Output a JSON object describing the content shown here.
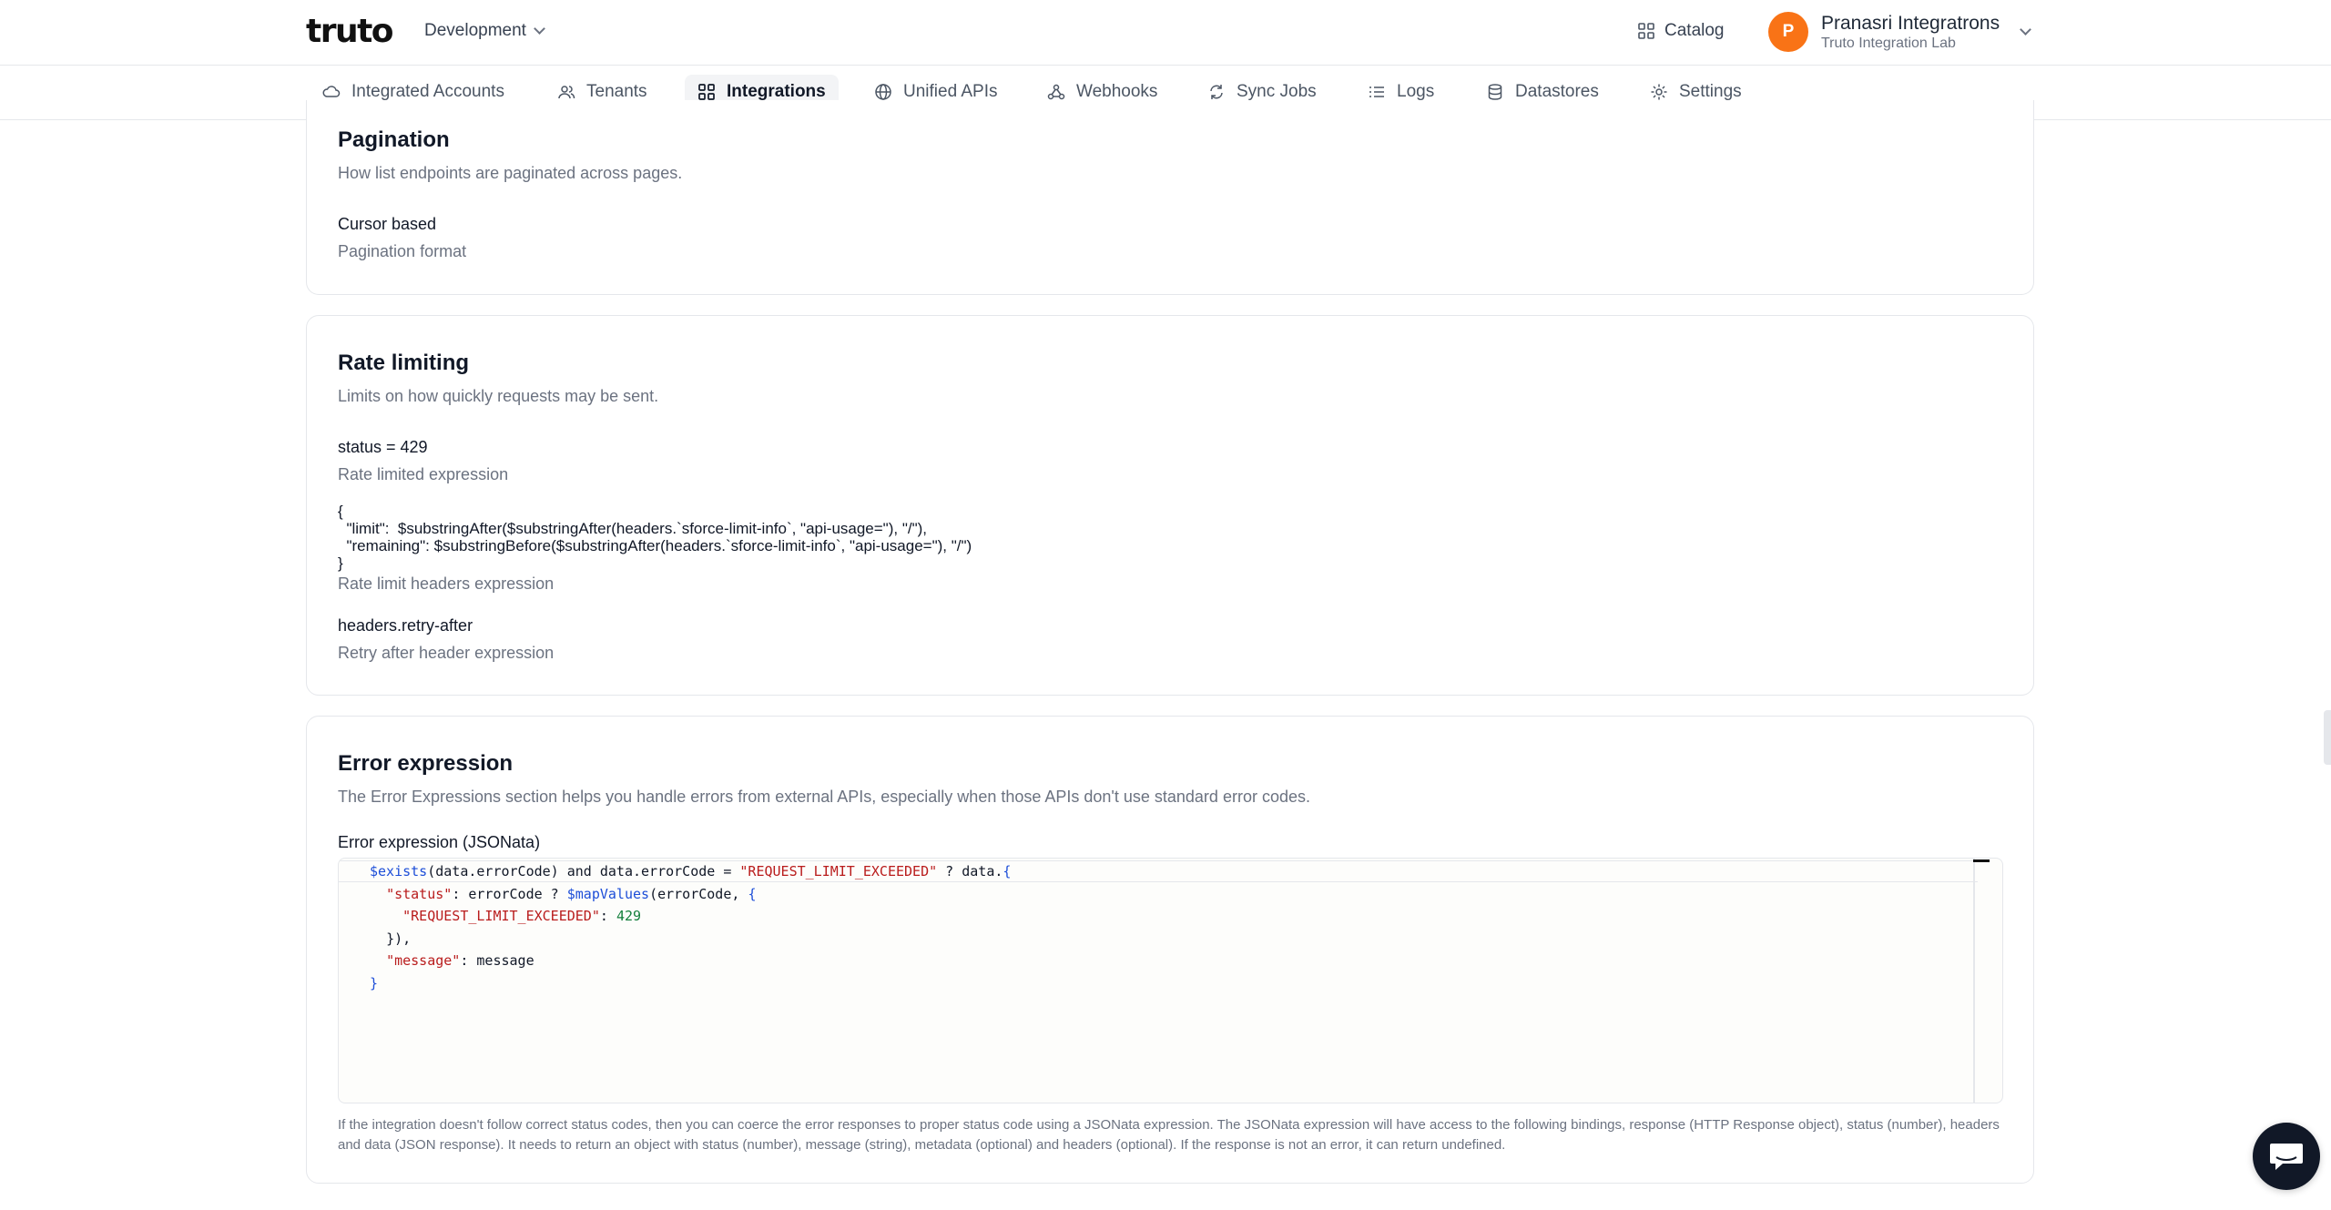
{
  "header": {
    "logo_text": "truto",
    "environment": "Development",
    "catalog_label": "Catalog",
    "user": {
      "initial": "P",
      "name": "Pranasri Integratrons",
      "org": "Truto Integration Lab"
    }
  },
  "nav": {
    "items": [
      {
        "label": "Integrated Accounts",
        "icon": "cloud-icon"
      },
      {
        "label": "Tenants",
        "icon": "users-icon"
      },
      {
        "label": "Integrations",
        "icon": "grid-icon",
        "active": true
      },
      {
        "label": "Unified APIs",
        "icon": "globe-icon"
      },
      {
        "label": "Webhooks",
        "icon": "webhook-icon"
      },
      {
        "label": "Sync Jobs",
        "icon": "sync-icon"
      },
      {
        "label": "Logs",
        "icon": "list-icon"
      },
      {
        "label": "Datastores",
        "icon": "database-icon"
      },
      {
        "label": "Settings",
        "icon": "gear-icon"
      }
    ]
  },
  "pagination": {
    "title": "Pagination",
    "subtitle": "How list endpoints are paginated across pages.",
    "value": "Cursor based",
    "label": "Pagination format"
  },
  "rate_limiting": {
    "title": "Rate limiting",
    "subtitle": "Limits on how quickly requests may be sent.",
    "rate_limited_value": "status = 429",
    "rate_limited_label": "Rate limited expression",
    "headers_expression": "{\n  \"limit\":  $substringAfter($substringAfter(headers.`sforce-limit-info`, \"api-usage=\"), \"/\"),\n  \"remaining\": $substringBefore($substringAfter(headers.`sforce-limit-info`, \"api-usage=\"), \"/\")\n}",
    "headers_label": "Rate limit headers expression",
    "retry_value": "headers.retry-after",
    "retry_label": "Retry after header expression"
  },
  "error_expression": {
    "title": "Error expression",
    "subtitle": "The Error Expressions section helps you handle errors from external APIs, especially when those APIs don't use standard error codes.",
    "field_label": "Error expression (JSONata)",
    "code": {
      "l1_fn": "$exists",
      "l1_a": "(data.errorCode) and data.errorCode = ",
      "l1_str": "\"REQUEST_LIMIT_EXCEEDED\"",
      "l1_b": " ? data.",
      "l1_br": "{",
      "l2_key": "\"status\"",
      "l2_a": ": errorCode ? ",
      "l2_fn": "$mapValues",
      "l2_b": "(errorCode, ",
      "l2_br": "{",
      "l3_key": "\"REQUEST_LIMIT_EXCEEDED\"",
      "l3_a": ": ",
      "l3_num": "429",
      "l4": "}),",
      "l5_key": "\"message\"",
      "l5_a": ": message",
      "l6": "}"
    },
    "help_text": "If the integration doesn't follow correct status codes, then you can coerce the error responses to proper status code using a JSONata expression. The JSONata expression will have access to the following bindings, response (HTTP Response object), status (number), headers and data (JSON response). It needs to return an object with status (number), message (string), metadata (optional) and headers (optional). If the response is not an error, it can return undefined."
  }
}
